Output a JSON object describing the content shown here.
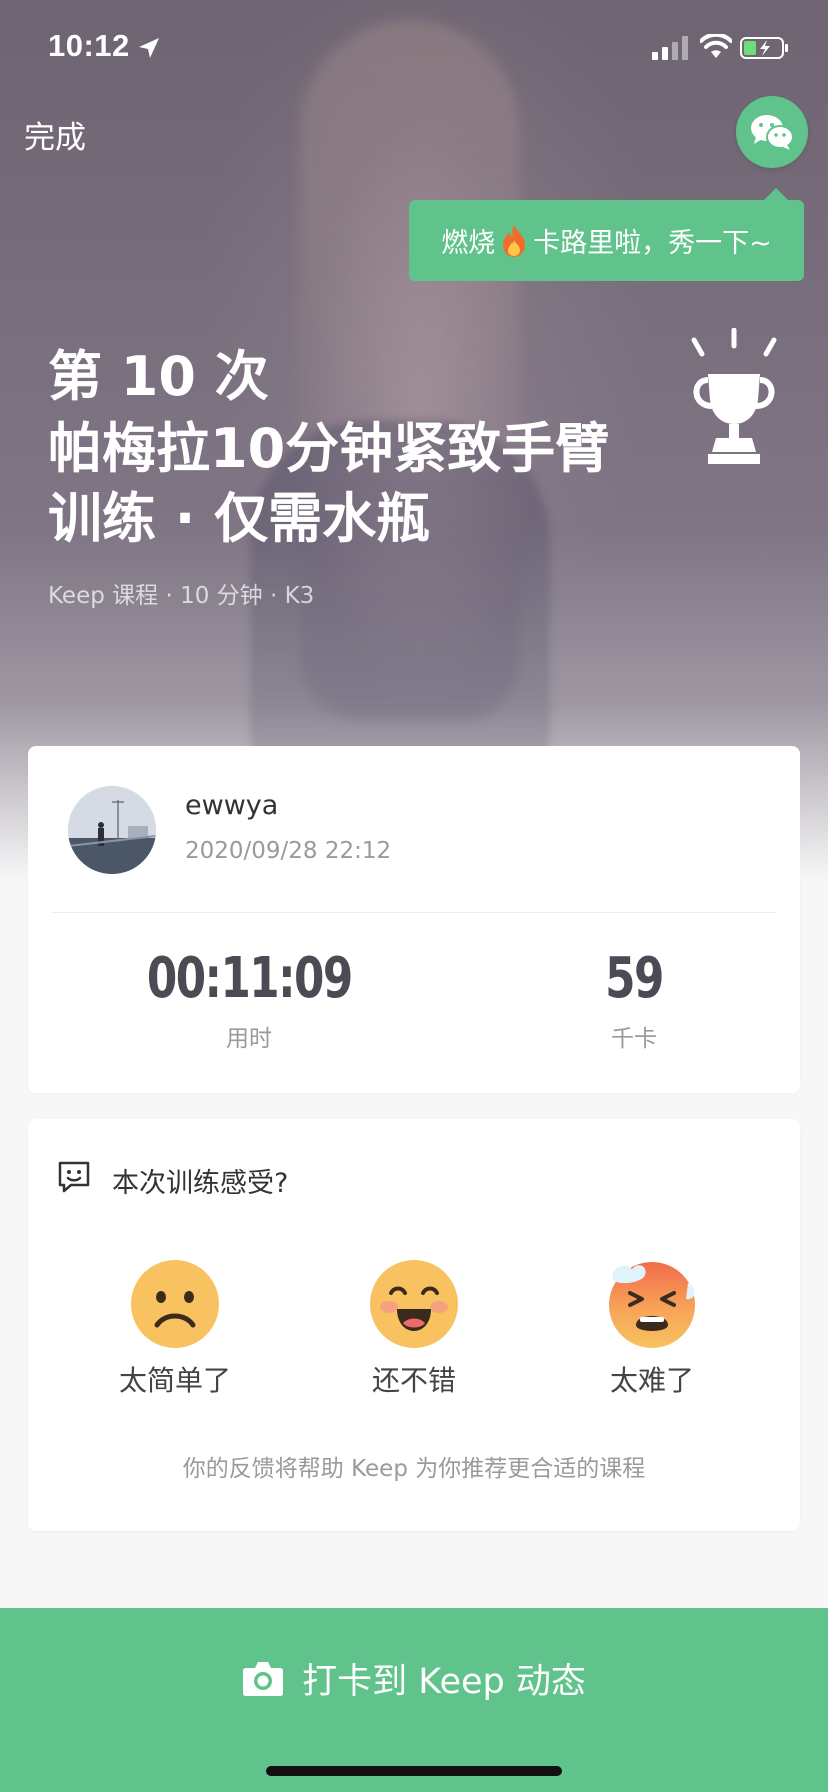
{
  "status_bar": {
    "time": "10:12"
  },
  "header": {
    "done_label": "完成",
    "share_tooltip_before": "燃烧",
    "share_tooltip_after": "卡路里啦，秀一下~"
  },
  "course": {
    "attempt_label": "第 10 次",
    "title": "帕梅拉10分钟紧致手臂训练 · 仅需水瓶",
    "meta": "Keep 课程 · 10 分钟 · K3"
  },
  "record": {
    "username": "ewwya",
    "datetime": "2020/09/28 22:12",
    "duration_value": "00:11:09",
    "duration_label": "用时",
    "calories_value": "59",
    "calories_label": "千卡"
  },
  "feedback": {
    "question": "本次训练感受?",
    "options": [
      {
        "label": "太简单了",
        "icon": "sad-face-icon"
      },
      {
        "label": "还不错",
        "icon": "smile-face-icon"
      },
      {
        "label": "太难了",
        "icon": "exhausted-face-icon"
      }
    ],
    "hint": "你的反馈将帮助 Keep 为你推荐更合适的课程"
  },
  "bottom": {
    "checkin_label": "打卡到 Keep 动态"
  },
  "colors": {
    "accent": "#5fc38b",
    "emoji_yellow": "#f7c25f"
  }
}
